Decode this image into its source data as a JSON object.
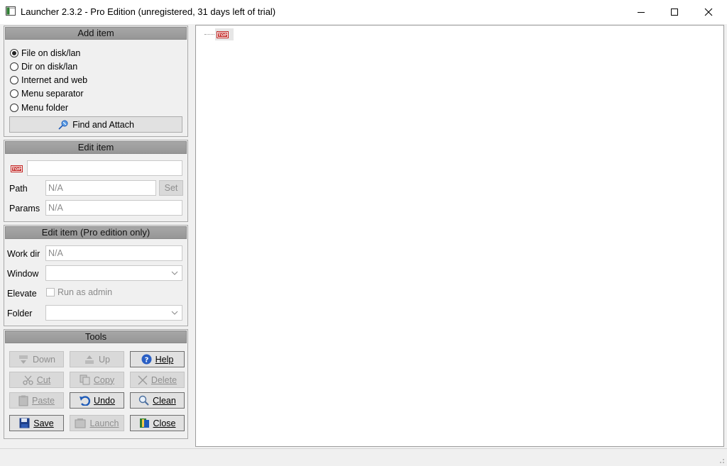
{
  "window": {
    "title": "Launcher 2.3.2 - Pro Edition (unregistered, 31 days left of trial)",
    "controls": [
      "minimize-icon",
      "maximize-icon",
      "close-icon"
    ]
  },
  "add_item": {
    "header": "Add item",
    "options": [
      {
        "label": "File on disk/lan",
        "checked": true
      },
      {
        "label": "Dir on disk/lan",
        "checked": false
      },
      {
        "label": "Internet and web",
        "checked": false
      },
      {
        "label": "Menu separator",
        "checked": false
      },
      {
        "label": "Menu folder",
        "checked": false
      }
    ],
    "find_attach": "Find and Attach"
  },
  "edit_item": {
    "header": "Edit item",
    "name_value": "",
    "path_label": "Path",
    "path_value": "N/A",
    "set_button": "Set",
    "params_label": "Params",
    "params_value": "N/A"
  },
  "edit_item_pro": {
    "header": "Edit item (Pro edition only)",
    "workdir_label": "Work dir",
    "workdir_value": "N/A",
    "window_label": "Window",
    "window_value": "",
    "elevate_label": "Elevate",
    "run_as_admin": "Run as admin",
    "run_as_admin_checked": false,
    "folder_label": "Folder",
    "folder_value": ""
  },
  "tools": {
    "header": "Tools",
    "buttons": {
      "down": {
        "label": "Down",
        "enabled": false
      },
      "up": {
        "label": "Up",
        "enabled": false
      },
      "help": {
        "label": "Help",
        "enabled": true
      },
      "cut": {
        "label": "Cut",
        "enabled": false
      },
      "copy": {
        "label": "Copy",
        "enabled": false
      },
      "delete": {
        "label": "Delete",
        "enabled": false
      },
      "paste": {
        "label": "Paste",
        "enabled": false
      },
      "undo": {
        "label": "Undo",
        "enabled": true
      },
      "clean": {
        "label": "Clean",
        "enabled": true
      },
      "save": {
        "label": "Save",
        "enabled": true
      },
      "launch": {
        "label": "Launch",
        "enabled": false
      },
      "close": {
        "label": "Close",
        "enabled": true
      }
    }
  },
  "tree": {
    "root_icon": "top-menu-icon",
    "root_badge": "T P"
  },
  "colors": {
    "header_bg": "#9e9e9e",
    "accent_blue": "#1e5bb8",
    "top_icon_red": "#c0201e"
  }
}
